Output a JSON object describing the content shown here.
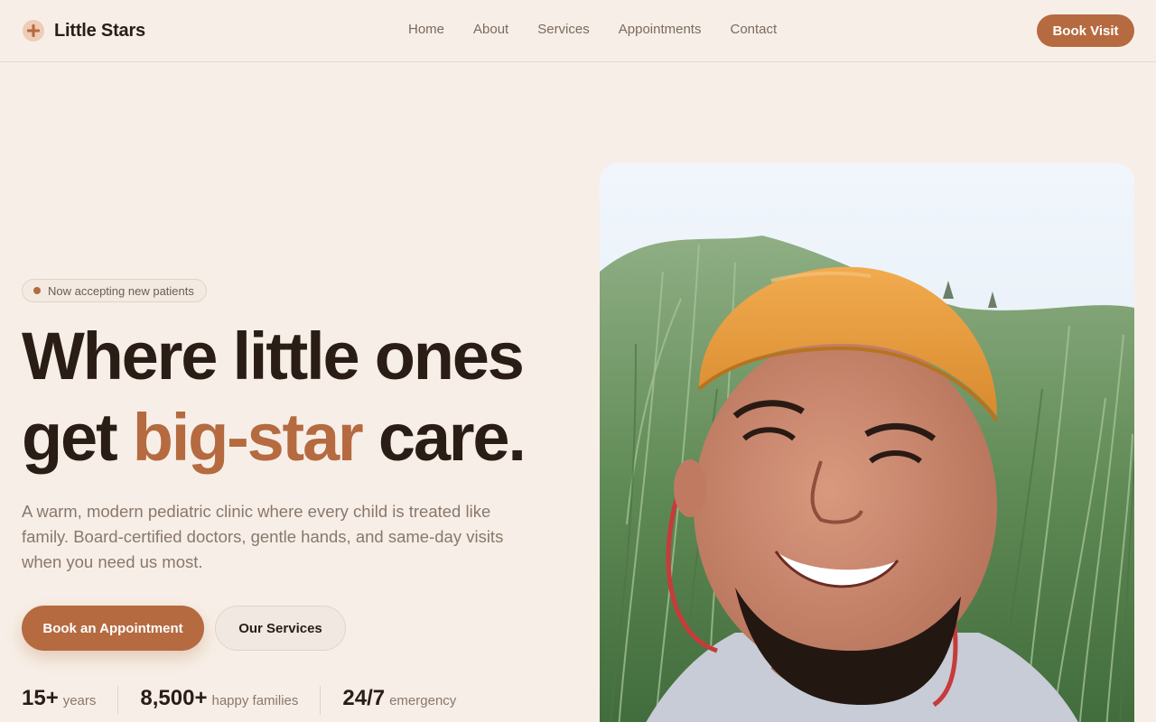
{
  "brand": {
    "name": "Little Stars",
    "logo_icon": "plus-icon",
    "accent_color": "#b56a40"
  },
  "nav": {
    "items": [
      {
        "label": "Home"
      },
      {
        "label": "About"
      },
      {
        "label": "Services"
      },
      {
        "label": "Appointments"
      },
      {
        "label": "Contact"
      }
    ],
    "cta_label": "Book Visit"
  },
  "hero": {
    "badge": "Now accepting new patients",
    "headline_line1": "Where little ones",
    "headline_pre": "get ",
    "headline_accent": "big-star",
    "headline_post": " care.",
    "subtitle": "A warm, modern pediatric clinic where every child is treated like family. Board-certified doctors, gentle hands, and same-day visits when you need us most.",
    "primary_button": "Book an Appointment",
    "secondary_button": "Our Services",
    "image_icon": "smiling-man-in-orange-cap-photo"
  },
  "stats": [
    {
      "value": "15+",
      "label": "years"
    },
    {
      "value": "8,500+",
      "label": "happy families"
    },
    {
      "value": "24/7",
      "label": "emergency"
    }
  ]
}
